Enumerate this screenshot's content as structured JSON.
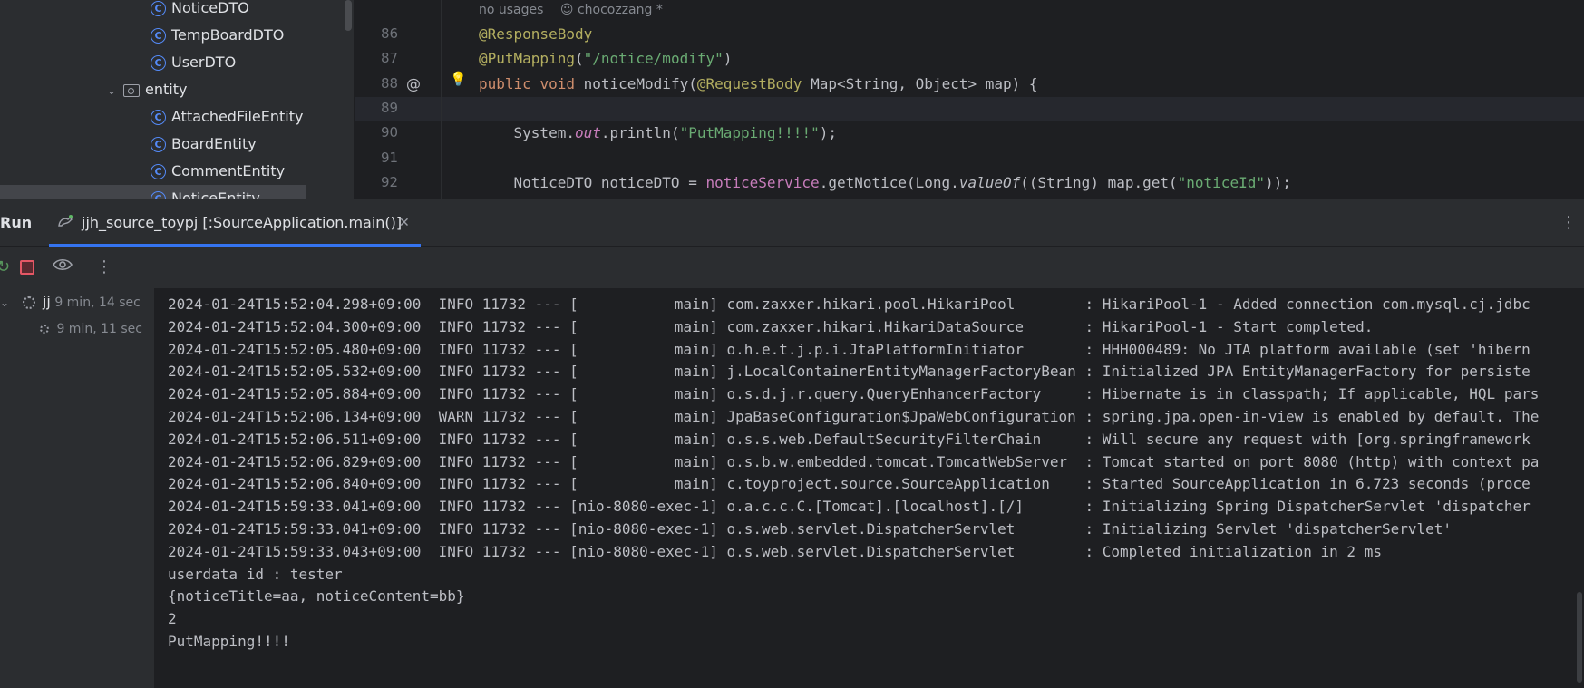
{
  "project_tree": {
    "items": [
      {
        "label": "NoticeDTO",
        "icon": "class-icon",
        "depth": 2
      },
      {
        "label": "TempBoardDTO",
        "icon": "class-icon",
        "depth": 2
      },
      {
        "label": "UserDTO",
        "icon": "class-icon",
        "depth": 2
      },
      {
        "label": "entity",
        "icon": "package-folder-icon",
        "depth": 1,
        "expanded": true
      },
      {
        "label": "AttachedFileEntity",
        "icon": "class-icon",
        "depth": 2
      },
      {
        "label": "BoardEntity",
        "icon": "class-icon",
        "depth": 2
      },
      {
        "label": "CommentEntity",
        "icon": "class-icon",
        "depth": 2
      },
      {
        "label": "NoticeEntity",
        "icon": "class-icon",
        "depth": 2,
        "selected": true
      }
    ]
  },
  "editor": {
    "inlay_hint": {
      "usages": "no usages",
      "author": "chocozzang *"
    },
    "lines": [
      {
        "num": "86",
        "tokens": [
          [
            "ann",
            "@ResponseBody"
          ]
        ]
      },
      {
        "num": "87",
        "tokens": [
          [
            "ann",
            "@PutMapping"
          ],
          [
            "gray",
            "("
          ],
          [
            "str",
            "\"/notice/modify\""
          ],
          [
            "gray",
            ")"
          ]
        ]
      },
      {
        "num": "88",
        "tokens": [
          [
            "kw",
            "public "
          ],
          [
            "kw",
            "void "
          ],
          [
            "gray",
            "noticeModify("
          ],
          [
            "ann",
            "@RequestBody "
          ],
          [
            "gray",
            "Map<String, Object> map) {"
          ]
        ]
      },
      {
        "num": "89",
        "tokens": []
      },
      {
        "num": "90",
        "tokens": [
          [
            "gray",
            "    System."
          ],
          [
            "ital",
            "out"
          ],
          [
            "gray",
            ".println("
          ],
          [
            "str",
            "\"PutMapping!!!!\""
          ],
          [
            "gray",
            ");"
          ]
        ]
      },
      {
        "num": "91",
        "tokens": []
      },
      {
        "num": "92",
        "tokens": [
          [
            "gray",
            "    NoticeDTO noticeDTO = "
          ],
          [
            "fld",
            "noticeService"
          ],
          [
            "gray",
            ".getNotice(Long."
          ],
          [
            "static-call",
            "valueOf"
          ],
          [
            "gray",
            "((String) map.get("
          ],
          [
            "str",
            "\"noticeId\""
          ],
          [
            "gray",
            "));"
          ]
        ]
      }
    ]
  },
  "run_panel": {
    "label": "Run",
    "tab_title": "jjh_source_toypj [:SourceApplication.main()]",
    "tree": [
      {
        "name": "jj",
        "time": "9 min, 14 sec"
      },
      {
        "name": "",
        "time": "9 min, 11 sec"
      }
    ],
    "console_lines": [
      "2024-01-24T15:52:04.298+09:00  INFO 11732 --- [           main] com.zaxxer.hikari.pool.HikariPool        : HikariPool-1 - Added connection com.mysql.cj.jdbc",
      "2024-01-24T15:52:04.300+09:00  INFO 11732 --- [           main] com.zaxxer.hikari.HikariDataSource       : HikariPool-1 - Start completed.",
      "2024-01-24T15:52:05.480+09:00  INFO 11732 --- [           main] o.h.e.t.j.p.i.JtaPlatformInitiator       : HHH000489: No JTA platform available (set 'hibern",
      "2024-01-24T15:52:05.532+09:00  INFO 11732 --- [           main] j.LocalContainerEntityManagerFactoryBean : Initialized JPA EntityManagerFactory for persiste",
      "2024-01-24T15:52:05.884+09:00  INFO 11732 --- [           main] o.s.d.j.r.query.QueryEnhancerFactory     : Hibernate is in classpath; If applicable, HQL pars",
      "2024-01-24T15:52:06.134+09:00  WARN 11732 --- [           main] JpaBaseConfiguration$JpaWebConfiguration : spring.jpa.open-in-view is enabled by default. The",
      "2024-01-24T15:52:06.511+09:00  INFO 11732 --- [           main] o.s.s.web.DefaultSecurityFilterChain     : Will secure any request with [org.springframework",
      "2024-01-24T15:52:06.829+09:00  INFO 11732 --- [           main] o.s.b.w.embedded.tomcat.TomcatWebServer  : Tomcat started on port 8080 (http) with context pa",
      "2024-01-24T15:52:06.840+09:00  INFO 11732 --- [           main] c.toyproject.source.SourceApplication    : Started SourceApplication in 6.723 seconds (proce",
      "2024-01-24T15:59:33.041+09:00  INFO 11732 --- [nio-8080-exec-1] o.a.c.c.C.[Tomcat].[localhost].[/]       : Initializing Spring DispatcherServlet 'dispatcher",
      "2024-01-24T15:59:33.041+09:00  INFO 11732 --- [nio-8080-exec-1] o.s.web.servlet.DispatcherServlet        : Initializing Servlet 'dispatcherServlet'",
      "2024-01-24T15:59:33.043+09:00  INFO 11732 --- [nio-8080-exec-1] o.s.web.servlet.DispatcherServlet        : Completed initialization in 2 ms",
      "userdata id : tester",
      "{noticeTitle=aa, noticeContent=bb}",
      "2",
      "PutMapping!!!!"
    ]
  }
}
